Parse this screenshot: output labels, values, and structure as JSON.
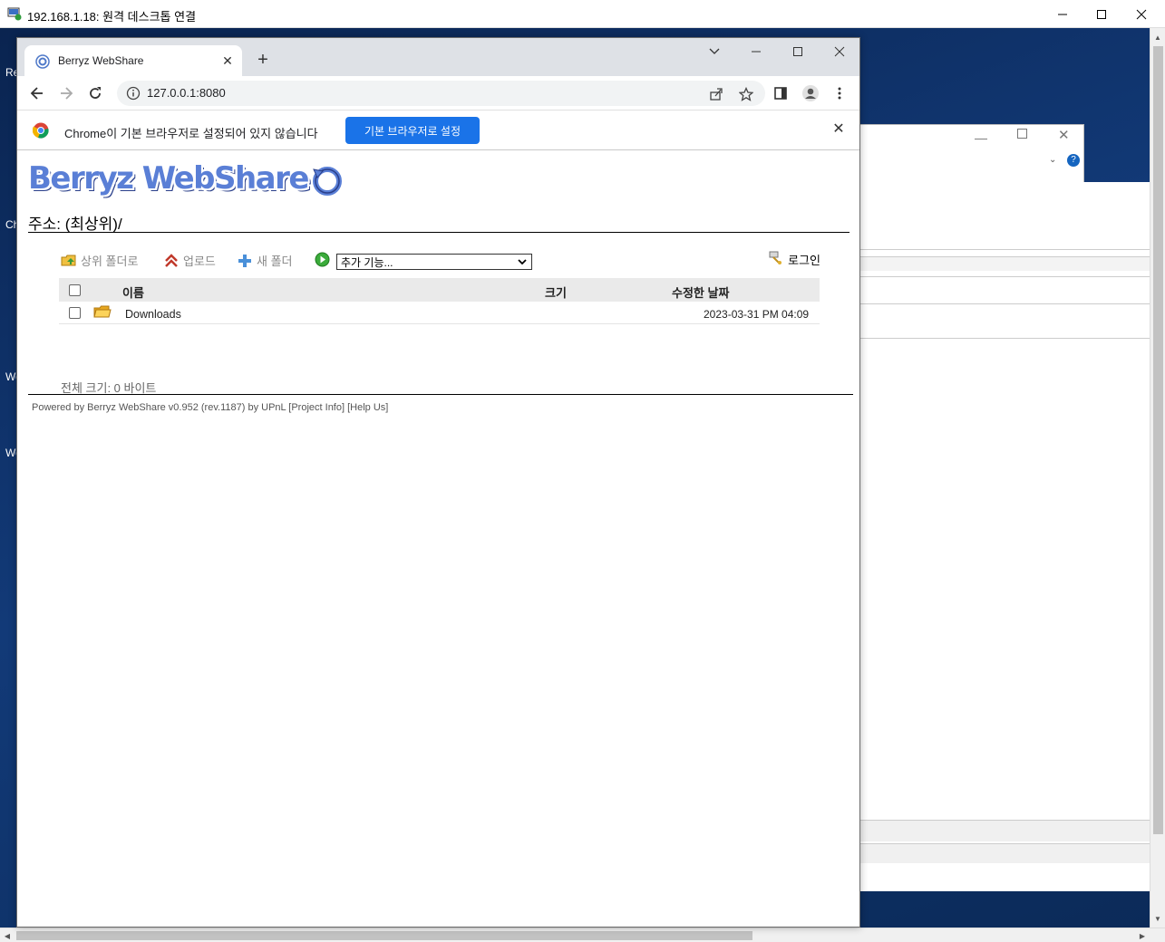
{
  "rdp": {
    "title": "192.168.1.18: 원격 데스크톱 연결",
    "desktop_labels": [
      "Re",
      "Ch",
      "We",
      "We"
    ]
  },
  "browser": {
    "tab_title": "Berryz WebShare",
    "url": "127.0.0.1:8080",
    "infobar_text": "Chrome이 기본 브라우저로 설정되어 있지 않습니다",
    "infobar_button": "기본 브라우저로 설정"
  },
  "page": {
    "logo_text": "Berryz WebShare",
    "path": "주소: (최상위)/",
    "actions": {
      "parent_folder": "상위 폴더로",
      "upload": "업로드",
      "new_folder": "새 폴더",
      "extra_select": "추가 기능...",
      "login": "로그인"
    },
    "table": {
      "headers": {
        "name": "이름",
        "size": "크기",
        "modified": "수정한 날짜"
      },
      "rows": [
        {
          "name": "Downloads",
          "size": "",
          "modified": "2023-03-31 PM 04:09"
        }
      ]
    },
    "total": "전체 크기: 0 바이트",
    "footer": "Powered by Berryz WebShare v0.952 (rev.1187) by UPnL [Project Info] [Help Us]"
  },
  "colors": {
    "chrome_button": "#1a73e8",
    "logo_blue": "#5a7fd6",
    "table_header_bg": "#eaeaea"
  }
}
